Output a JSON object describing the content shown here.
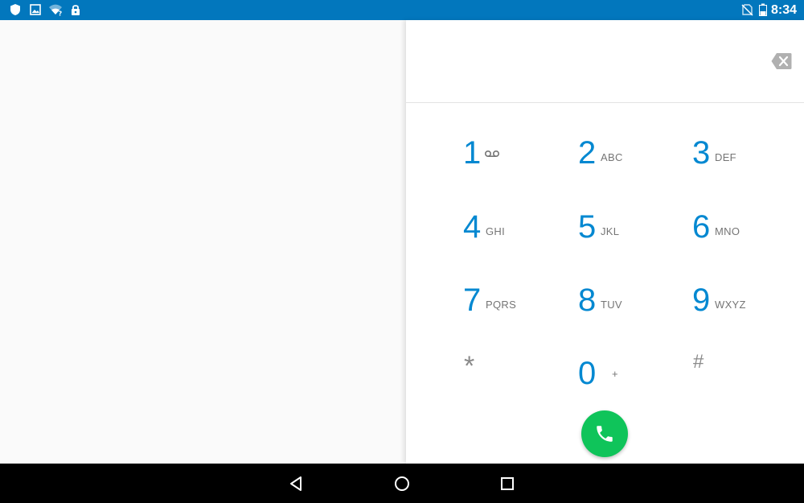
{
  "status_bar": {
    "time": "8:34",
    "left_icons": [
      "shield-icon",
      "image-icon",
      "wifi-question-icon",
      "lock-icon"
    ],
    "right_icons": [
      "no-sim-icon",
      "battery-icon"
    ],
    "background": "#0277bd"
  },
  "dialer": {
    "digits_value": "",
    "keys": [
      {
        "number": "1",
        "letters": "",
        "icon": "voicemail-icon"
      },
      {
        "number": "2",
        "letters": "ABC"
      },
      {
        "number": "3",
        "letters": "DEF"
      },
      {
        "number": "4",
        "letters": "GHI"
      },
      {
        "number": "5",
        "letters": "JKL"
      },
      {
        "number": "6",
        "letters": "MNO"
      },
      {
        "number": "7",
        "letters": "PQRS"
      },
      {
        "number": "8",
        "letters": "TUV"
      },
      {
        "number": "9",
        "letters": "WXYZ"
      },
      {
        "number": "*",
        "letters": ""
      },
      {
        "number": "0",
        "letters": "+"
      },
      {
        "number": "#",
        "letters": ""
      }
    ],
    "accent_color": "#0288d1",
    "call_button_color": "#0fc45a"
  },
  "nav_bar": {
    "buttons": [
      "back-icon",
      "home-icon",
      "recents-icon"
    ]
  }
}
